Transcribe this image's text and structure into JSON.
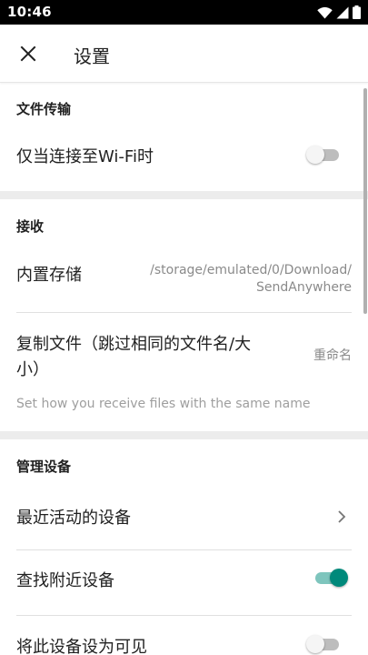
{
  "status_bar": {
    "time": "10:46",
    "icons": [
      "wifi-icon",
      "signal-icon",
      "battery-icon"
    ]
  },
  "app_bar": {
    "close_icon": "close-icon",
    "title": "设置"
  },
  "sections": {
    "file_transfer": {
      "header": "文件传输",
      "wifi_only": {
        "label": "仅当连接至Wi-Fi时",
        "enabled": false
      }
    },
    "receive": {
      "header": "接收",
      "storage": {
        "label": "内置存储",
        "path_line1": "/storage/emulated/0/Download/",
        "path_line2": "SendAnywhere"
      },
      "duplicate": {
        "label_line1": "复制文件（跳过相同的文件名/大",
        "label_line2": "小）",
        "value": "重命名",
        "helper": "Set how you receive files with the same name"
      }
    },
    "manage_devices": {
      "header": "管理设备",
      "recent": {
        "label": "最近活动的设备",
        "icon": "chevron-right-icon"
      },
      "find_nearby": {
        "label": "查找附近设备",
        "enabled": true
      },
      "visible": {
        "label": "将此设备设为可见",
        "enabled": false
      }
    }
  },
  "colors": {
    "accent": "#00897b",
    "accent_track": "#7ec5bd",
    "status_bar": "#000000",
    "section_divider": "#ececec"
  }
}
